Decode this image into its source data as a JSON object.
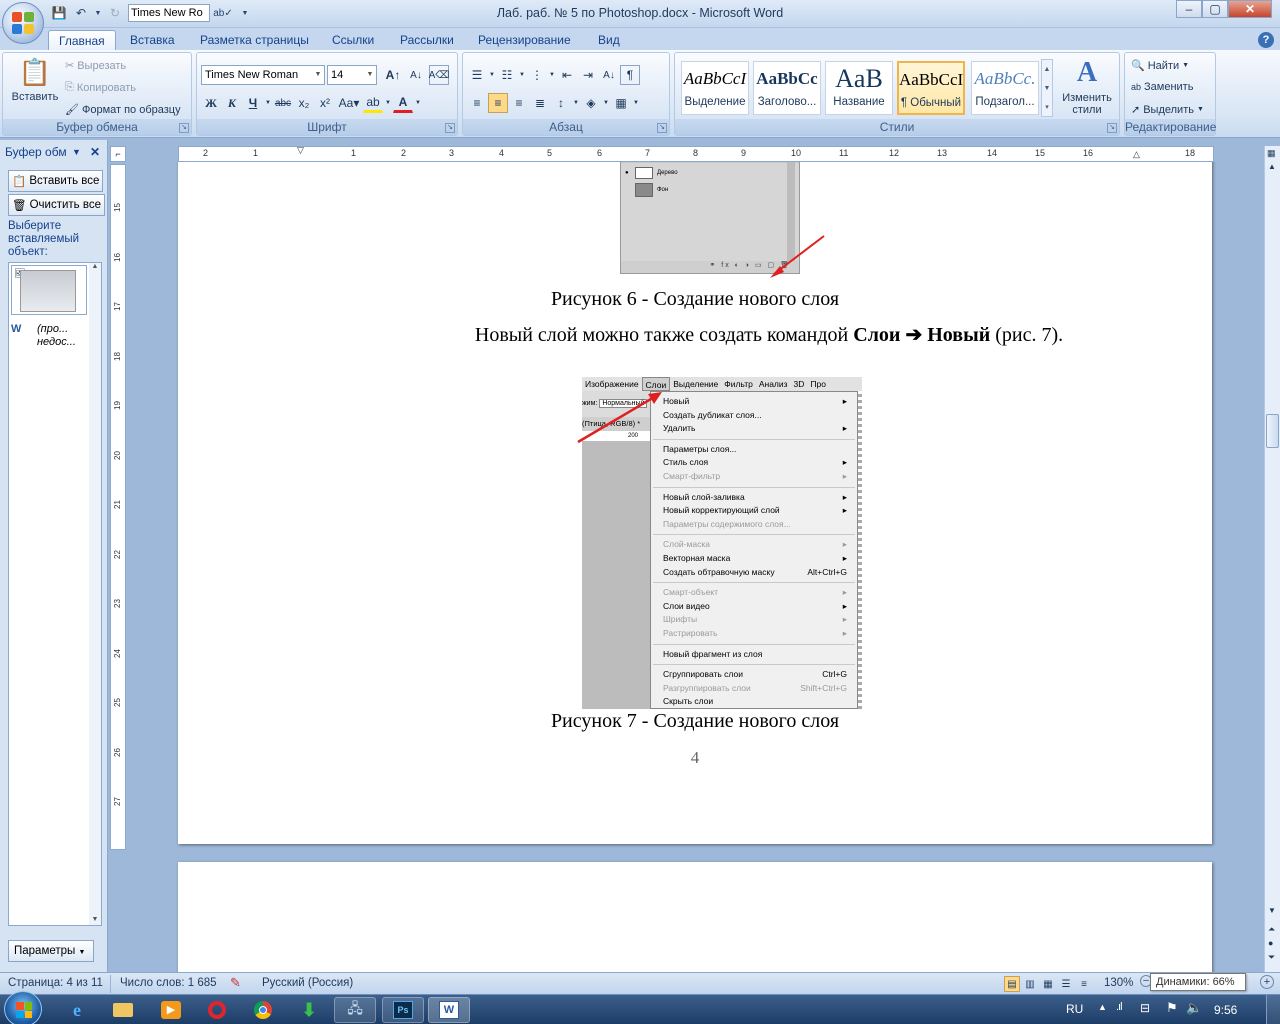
{
  "window": {
    "title": "Лаб. раб. № 5 по Photoshop.docx - Microsoft Word",
    "qat_font": "Times New Ro",
    "controls": {
      "minimize": "–",
      "maximize": "▢",
      "close": "✕"
    }
  },
  "tabs": [
    "Главная",
    "Вставка",
    "Разметка страницы",
    "Ссылки",
    "Рассылки",
    "Рецензирование",
    "Вид"
  ],
  "ribbon": {
    "clipboard": {
      "label": "Буфер обмена",
      "paste": "Вставить",
      "cut": "Вырезать",
      "copy": "Копировать",
      "format_painter": "Формат по образцу"
    },
    "font": {
      "label": "Шрифт",
      "name": "Times New Roman",
      "size": "14"
    },
    "paragraph": {
      "label": "Абзац"
    },
    "styles": {
      "label": "Стили",
      "change_styles": "Изменить стили",
      "items": [
        {
          "sample": "AaBbCcI",
          "name": "Выделение"
        },
        {
          "sample": "AaBbCc",
          "name": "Заголово..."
        },
        {
          "sample": "AaB",
          "name": "Название"
        },
        {
          "sample": "AaBbCcI",
          "name": "¶ Обычный"
        },
        {
          "sample": "AaBbCc.",
          "name": "Подзагол..."
        }
      ]
    },
    "editing": {
      "label": "Редактирование",
      "find": "Найти",
      "replace": "Заменить",
      "select": "Выделить"
    }
  },
  "clipboard_pane": {
    "title": "Буфер обм",
    "paste_all": "Вставить все",
    "clear_all": "Очистить все",
    "hint": "Выберите вставляемый объект:",
    "item2": "(про... недос...",
    "options": "Параметры"
  },
  "document": {
    "caption6": "Рисунок 6 - Создание нового слоя",
    "para_pre": "Новый слой можно также создать командой ",
    "para_b1": "Слои",
    "para_b2": "Новый",
    "para_post": " (рис. 7).",
    "caption7": "Рисунок 7 - Создание нового слоя",
    "page_number": "4",
    "shot1_layers": [
      "Дерево",
      "Фон"
    ],
    "ps_menubar": [
      "Изображение",
      "Слои",
      "Выделение",
      "Фильтр",
      "Анализ",
      "3D",
      "Про"
    ],
    "ps_side": {
      "mode_label": "жим:",
      "mode_value": "Нормальный",
      "doc_tab": "(Птица, RGB/8) *",
      "ruler": "200"
    },
    "ps_menu": [
      {
        "label": "Новый",
        "sub": true,
        "disabled": false
      },
      {
        "label": "Создать дубликат слоя...",
        "sub": false,
        "disabled": false
      },
      {
        "label": "Удалить",
        "sub": true,
        "disabled": false
      },
      {
        "sep": true
      },
      {
        "label": "Параметры слоя...",
        "sub": false,
        "disabled": false
      },
      {
        "label": "Стиль слоя",
        "sub": true,
        "disabled": false
      },
      {
        "label": "Смарт-фильтр",
        "sub": true,
        "disabled": true
      },
      {
        "sep": true
      },
      {
        "label": "Новый слой-заливка",
        "sub": true,
        "disabled": false
      },
      {
        "label": "Новый корректирующий слой",
        "sub": true,
        "disabled": false
      },
      {
        "label": "Параметры содержимого слоя...",
        "sub": false,
        "disabled": true
      },
      {
        "sep": true
      },
      {
        "label": "Слой-маска",
        "sub": true,
        "disabled": true
      },
      {
        "label": "Векторная маска",
        "sub": true,
        "disabled": false
      },
      {
        "label": "Создать обтравочную маску",
        "shortcut": "Alt+Ctrl+G",
        "sub": false,
        "disabled": false
      },
      {
        "sep": true
      },
      {
        "label": "Смарт-объект",
        "sub": true,
        "disabled": true
      },
      {
        "label": "Слои видео",
        "sub": true,
        "disabled": false
      },
      {
        "label": "Шрифты",
        "sub": true,
        "disabled": true
      },
      {
        "label": "Растрировать",
        "sub": true,
        "disabled": true
      },
      {
        "sep": true
      },
      {
        "label": "Новый фрагмент из слоя",
        "sub": false,
        "disabled": false
      },
      {
        "sep": true
      },
      {
        "label": "Сгруппировать слои",
        "shortcut": "Ctrl+G",
        "sub": false,
        "disabled": false
      },
      {
        "label": "Разгруппировать слои",
        "shortcut": "Shift+Ctrl+G",
        "sub": false,
        "disabled": true
      },
      {
        "label": "Скрыть слои",
        "sub": false,
        "disabled": false
      }
    ]
  },
  "hruler_ticks": [
    "2",
    "1",
    "1",
    "2",
    "3",
    "4",
    "5",
    "6",
    "7",
    "8",
    "9",
    "10",
    "11",
    "12",
    "13",
    "14",
    "15",
    "16",
    "18"
  ],
  "vruler_ticks": [
    "15",
    "16",
    "17",
    "18",
    "19",
    "20",
    "21",
    "22",
    "23",
    "24",
    "25",
    "26",
    "27"
  ],
  "status": {
    "page": "Страница: 4 из 11",
    "words": "Число слов: 1 685",
    "language": "Русский (Россия)",
    "zoom": "130%",
    "tooltip": "Динамики: 66%"
  },
  "taskbar": {
    "lang": "RU",
    "time": "9:56",
    "ps_label": "Ps"
  },
  "colors": {
    "ribbon_accent": "#15428b",
    "selected_style": "#f0b44a",
    "red_arrow": "#e02020"
  }
}
